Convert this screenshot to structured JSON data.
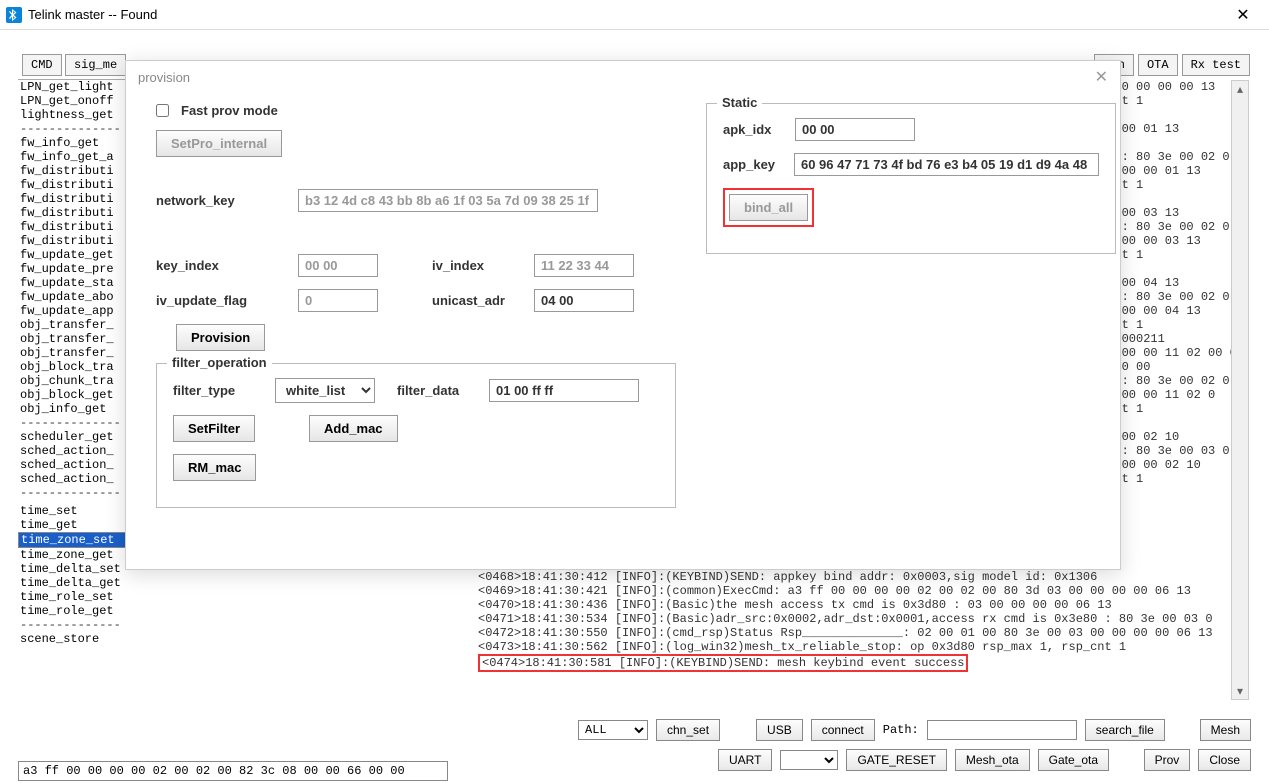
{
  "window": {
    "title": "Telink master -- Found"
  },
  "topbar": {
    "cmd": "CMD",
    "sig_me": "sig_me",
    "can": "can",
    "ota": "OTA",
    "rx_test": "Rx test"
  },
  "cmd_list": {
    "items_a": [
      "LPN_get_light",
      "LPN_get_onoff",
      "lightness_get"
    ],
    "items_b": [
      "fw_info_get",
      "fw_info_get_a",
      "fw_distributi",
      "fw_distributi",
      "fw_distributi",
      "fw_distributi",
      "fw_distributi",
      "fw_distributi",
      "fw_update_get",
      "fw_update_pre",
      "fw_update_sta",
      "fw_update_abo",
      "fw_update_app",
      "obj_transfer_",
      "obj_transfer_",
      "obj_transfer_",
      "obj_block_tra",
      "obj_chunk_tra",
      "obj_block_get",
      "obj_info_get"
    ],
    "items_c": [
      "scheduler_get",
      "sched_action_",
      "sched_action_",
      "sched_action_"
    ],
    "items_d": [
      "time_set",
      "time_get",
      "time_zone_set",
      "time_zone_get",
      "time_delta_set",
      "time_delta_get",
      "time_role_set",
      "time_role_get"
    ],
    "items_e": [
      "scene_store"
    ],
    "selected": "time_zone_set",
    "sep": "--------------"
  },
  "cmd_input": "a3 ff 00 00 00 00 02 00 02 00 82 3c 08 00 00 66 00 00",
  "provision": {
    "title": "provision",
    "fast_prov_label": "Fast prov mode",
    "setpro": "SetPro_internal",
    "network_key_label": "network_key",
    "network_key": "b3 12 4d c8 43 bb 8b a6 1f 03 5a 7d 09 38 25 1f",
    "key_index_label": "key_index",
    "key_index": "00 00",
    "iv_index_label": "iv_index",
    "iv_index": "11 22 33 44",
    "iv_update_flag_label": "iv_update_flag",
    "iv_update_flag": "0",
    "unicast_adr_label": "unicast_adr",
    "unicast_adr": "04 00",
    "provision_btn": "Provision",
    "filter_legend": "filter_operation",
    "filter_type_label": "filter_type",
    "filter_type": "white_list",
    "filter_data_label": "filter_data",
    "filter_data": "01 00 ff ff",
    "setfilter": "SetFilter",
    "add_mac": "Add_mac",
    "rm_mac": "RM_mac",
    "static_legend": "Static",
    "apk_idx_label": "apk_idx",
    "apk_idx": "00 00",
    "app_key_label": "app_key",
    "app_key": "60 96 47 71 73 4f bd 76 e3 b4 05 19 d1 d9 4a 48",
    "bind_all": "bind_all"
  },
  "right_partial": [
    "2 00 00 00 00 13",
    "_cnt 1",
    "01",
    "00 00 01 13",
    "8",
    "80 : 80 3e 00 02 0",
    "00 00 00 01 13",
    "_cnt 1",
    "03",
    "00 00 03 13",
    "",
    "80 : 80 3e 00 02 0",
    "00 00 00 03 13",
    "_cnt 1",
    "04",
    "00 00 04 13",
    "",
    "80 : 80 3e 00 02 0",
    "00 00 00 04 13",
    "_cnt 1",
    "x00000211",
    "00 00 00 11 02 00 00",
    "2 00 00",
    "80 : 80 3e 00 02 0",
    "00 00 00 11 02 0",
    "_cnt 1",
    "02",
    "00 00 02 10",
    "",
    "80 : 80 3e 00 03 0",
    "00 00 00 02 10",
    "_cnt 1"
  ],
  "log": [
    "<0468>18:41:30:412 [INFO]:(KEYBIND)SEND: appkey bind addr: 0x0003,sig model id: 0x1306",
    "<0469>18:41:30:421 [INFO]:(common)ExecCmd: a3 ff 00 00 00 00 02 00 02 00 80 3d 03 00 00 00 00 06 13",
    "<0470>18:41:30:436 [INFO]:(Basic)the mesh access tx cmd is 0x3d80 : 03 00 00 00 00 06 13",
    "<0471>18:41:30:534 [INFO]:(Basic)adr_src:0x0002,adr_dst:0x0001,access rx cmd is 0x3e80 : 80 3e 00 03 0",
    "<0472>18:41:30:550 [INFO]:(cmd_rsp)Status Rsp______________: 02 00 01 00 80 3e 00 03 00 00 00 00 06 13",
    "<0473>18:41:30:562 [INFO]:(log_win32)mesh_tx_reliable_stop: op 0x3d80 rsp_max 1, rsp_cnt 1"
  ],
  "log_highlight": "<0474>18:41:30:581 [INFO]:(KEYBIND)SEND: mesh keybind event success",
  "bottom": {
    "all": "ALL",
    "chn_set": "chn_set",
    "usb": "USB",
    "connect": "connect",
    "path_label": "Path:",
    "path": "",
    "search_file": "search_file",
    "mesh": "Mesh",
    "uart": "UART",
    "uart_port": "",
    "gate_reset": "GATE_RESET",
    "mesh_ota": "Mesh_ota",
    "gate_ota": "Gate_ota",
    "prov": "Prov",
    "close": "Close"
  }
}
